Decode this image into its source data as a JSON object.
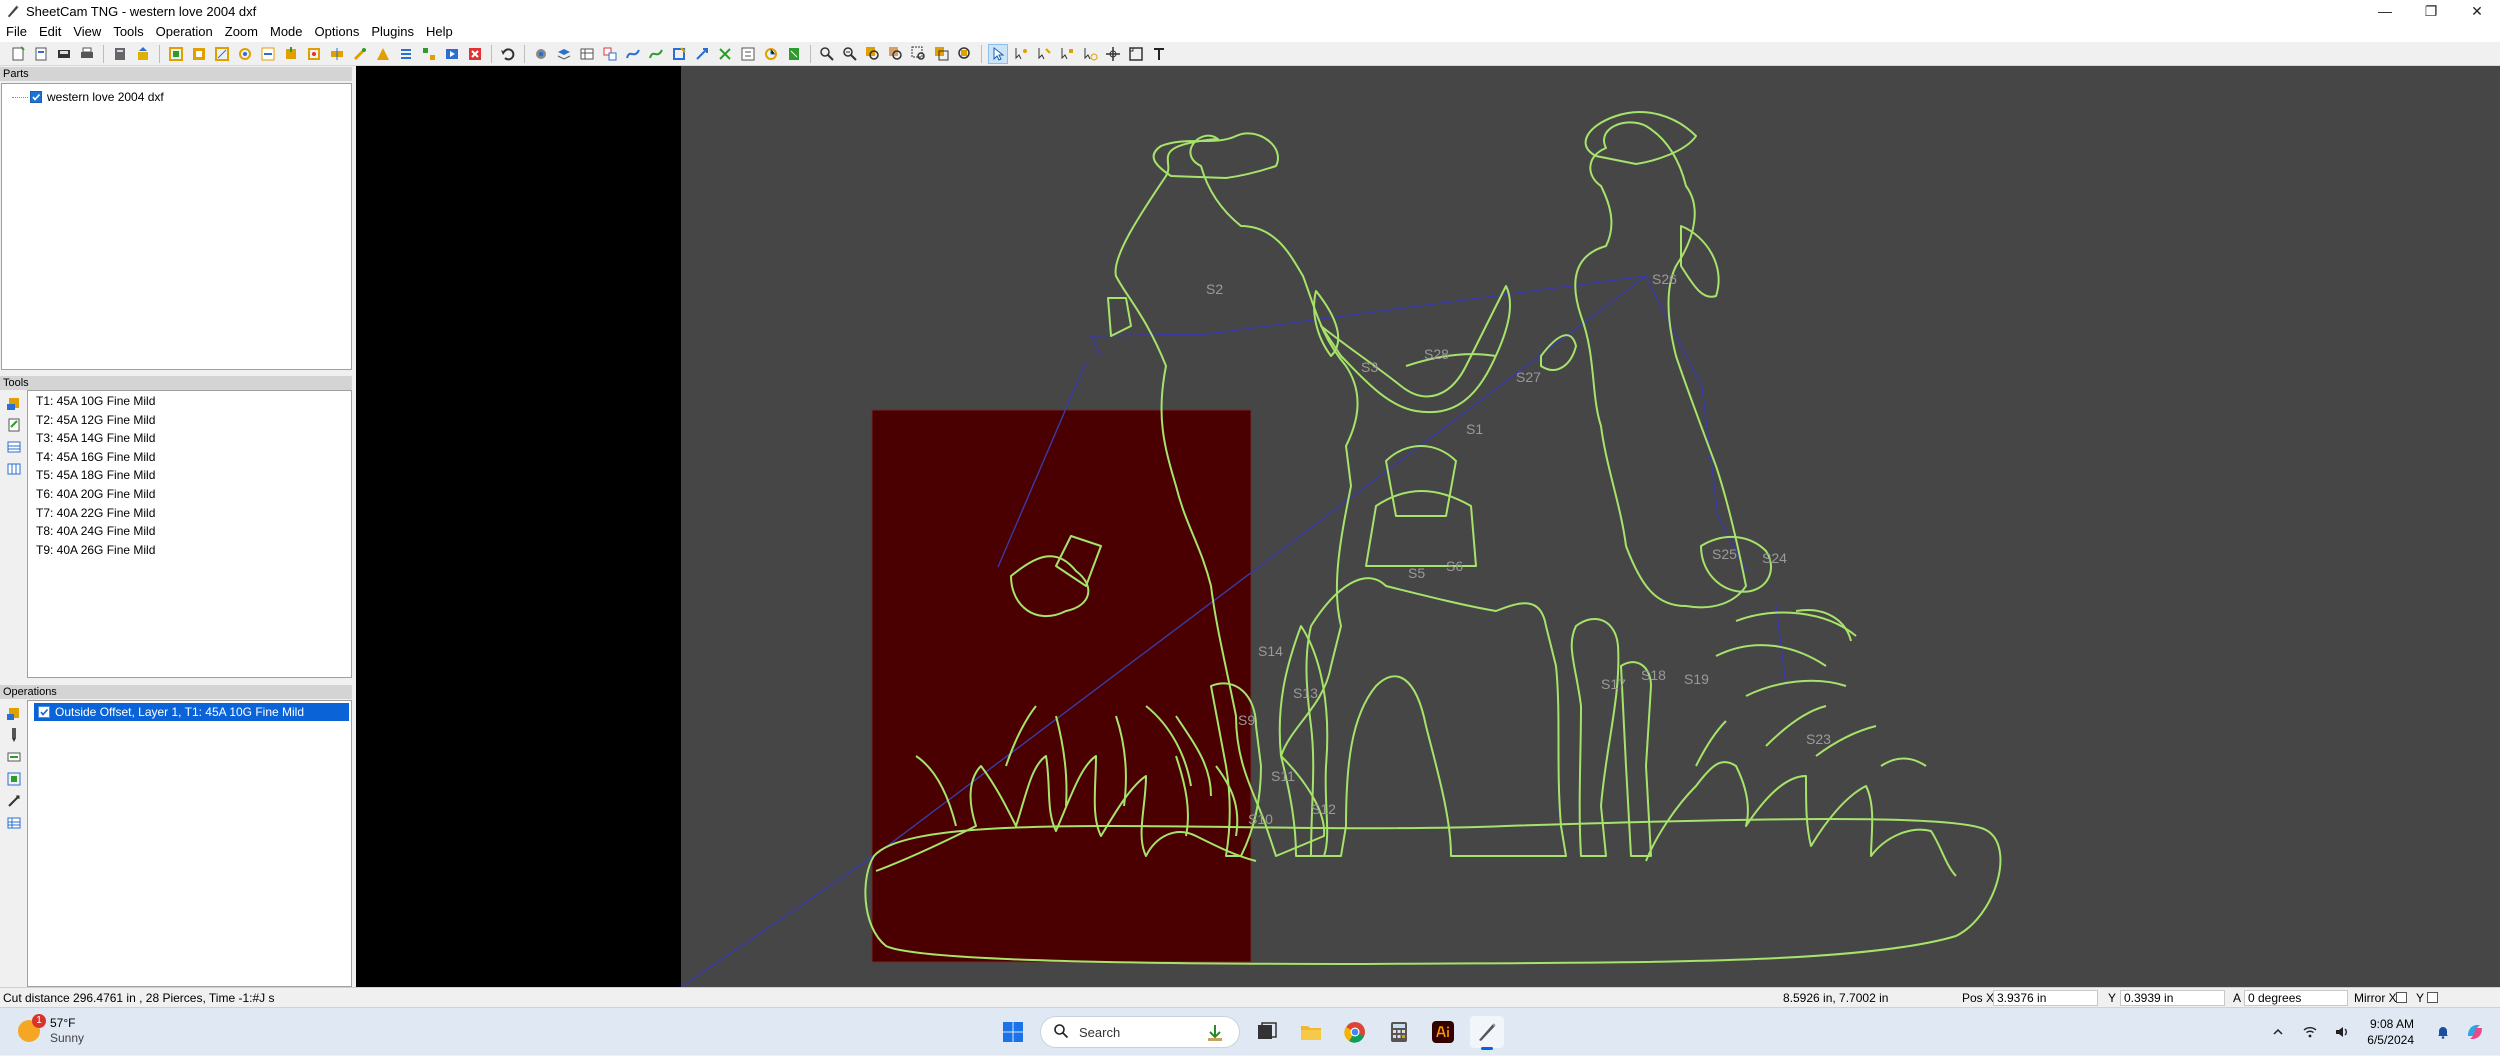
{
  "window": {
    "title": "SheetCam TNG - western love 2004 dxf",
    "minimize": "—",
    "maximize": "❐",
    "close": "✕"
  },
  "menu": [
    "File",
    "Edit",
    "View",
    "Tools",
    "Operation",
    "Zoom",
    "Mode",
    "Options",
    "Plugins",
    "Help"
  ],
  "parts": {
    "header": "Parts",
    "items": [
      {
        "label": "western love 2004 dxf",
        "checked": true
      }
    ]
  },
  "tools": {
    "header": "Tools",
    "items": [
      "T1: 45A 10G Fine Mild",
      "T2: 45A 12G Fine Mild",
      "T3: 45A 14G Fine Mild",
      "T4: 45A 16G Fine Mild",
      "T5: 45A 18G Fine Mild",
      "T6: 40A 20G Fine Mild",
      "T7: 40A 22G Fine Mild",
      "T8: 40A 24G Fine Mild",
      "T9: 40A 26G Fine Mild"
    ]
  },
  "operations": {
    "header": "Operations",
    "items": [
      {
        "label": "Outside Offset, Layer 1, T1: 45A 10G Fine Mild",
        "checked": true,
        "selected": true
      }
    ]
  },
  "canvas": {
    "labels": [
      "S2",
      "S26",
      "S28",
      "S3",
      "S27",
      "S1",
      "S25",
      "S24",
      "S5",
      "S6",
      "S14",
      "S13",
      "S17",
      "S18",
      "S19",
      "S9",
      "S11",
      "S12",
      "S10",
      "S23"
    ],
    "colors": {
      "background": "#464646",
      "black_area": "#000000",
      "stock": "#4a0000",
      "contour": "#a6e36a",
      "rapid": "#3a3aa8"
    }
  },
  "status": {
    "summary": "Cut distance 296.4761 in , 28 Pierces, Time -1:#J s",
    "cursor": "8.5926 in, 7.7002 in",
    "pos_x_label": "Pos X",
    "pos_x": "3.9376 in",
    "y_label": "Y",
    "y": "0.3939 in",
    "a_label": "A",
    "a": "0 degrees",
    "mirror_x": "Mirror X",
    "mirror_y": "Y"
  },
  "taskbar": {
    "temperature": "57°F",
    "condition": "Sunny",
    "weather_badge": "1",
    "search": "Search",
    "time": "9:08 AM",
    "date": "6/5/2024"
  }
}
